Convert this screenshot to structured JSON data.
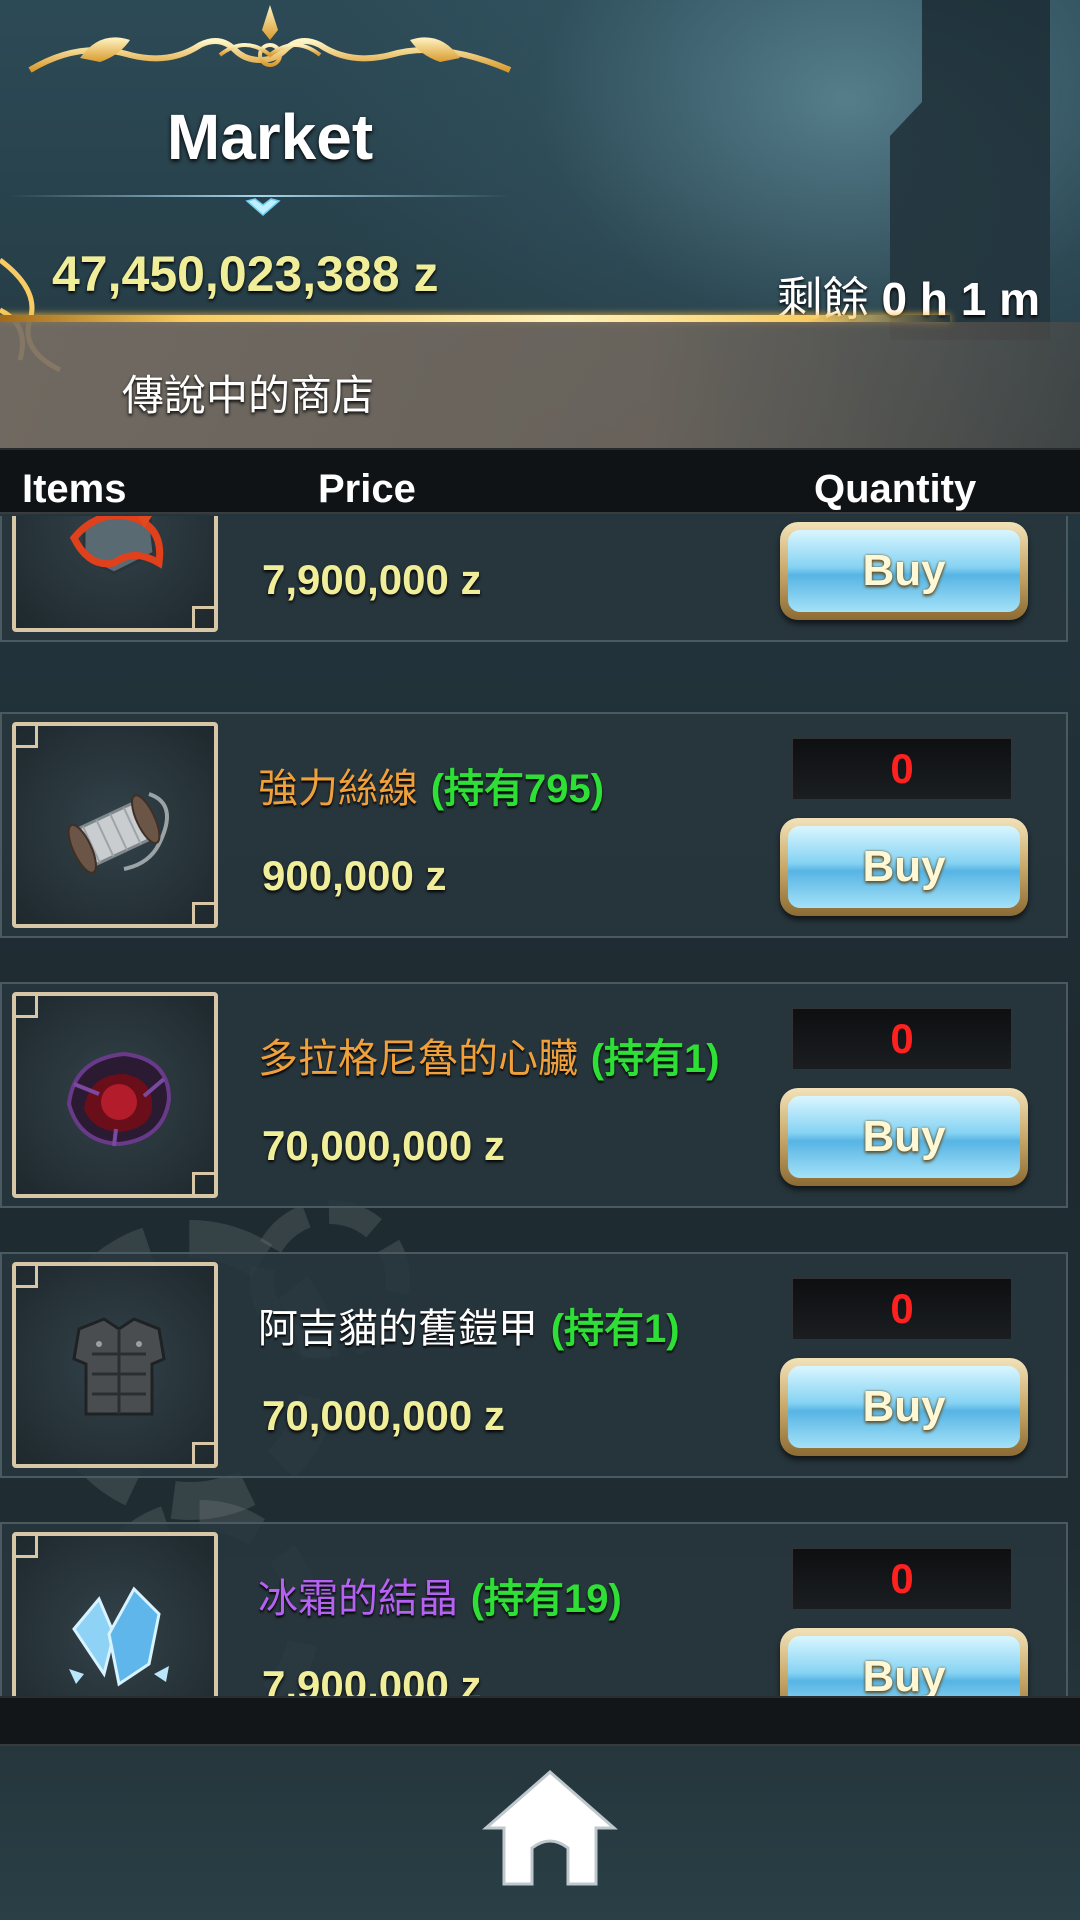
{
  "header": {
    "title": "Market",
    "currency": "47,450,023,388 z",
    "timer_label": "剩餘",
    "timer_value": "0 h 1 m",
    "shop_name": "傳說中的商店"
  },
  "columns": {
    "items": "Items",
    "price": "Price",
    "quantity": "Quantity"
  },
  "items": [
    {
      "name": "",
      "owned": "",
      "price": "7,900,000 z",
      "quantity": "",
      "buy_label": "Buy",
      "icon": "fire-crystal-icon"
    },
    {
      "name": "強力絲線",
      "owned": "(持有795)",
      "price": "900,000 z",
      "quantity": "0",
      "buy_label": "Buy",
      "icon": "thread-spool-icon"
    },
    {
      "name": "多拉格尼魯的心臟",
      "owned": "(持有1)",
      "price": "70,000,000 z",
      "quantity": "0",
      "buy_label": "Buy",
      "icon": "dragon-heart-icon"
    },
    {
      "name": "阿吉貓的舊鎧甲",
      "owned": "(持有1)",
      "price": "70,000,000 z",
      "quantity": "0",
      "buy_label": "Buy",
      "icon": "armor-icon"
    },
    {
      "name": "冰霜的結晶",
      "owned": "(持有19)",
      "price": "7,900,000 z",
      "quantity": "0",
      "buy_label": "Buy",
      "icon": "ice-crystal-icon"
    }
  ],
  "colors": {
    "price": "#f1ee9a",
    "owned": "#2ee036",
    "quantity": "#ff2020",
    "rarity_purple": "#b561f2",
    "rarity_orange": "#f0a03a"
  },
  "nav": {
    "home_icon": "home-icon"
  }
}
